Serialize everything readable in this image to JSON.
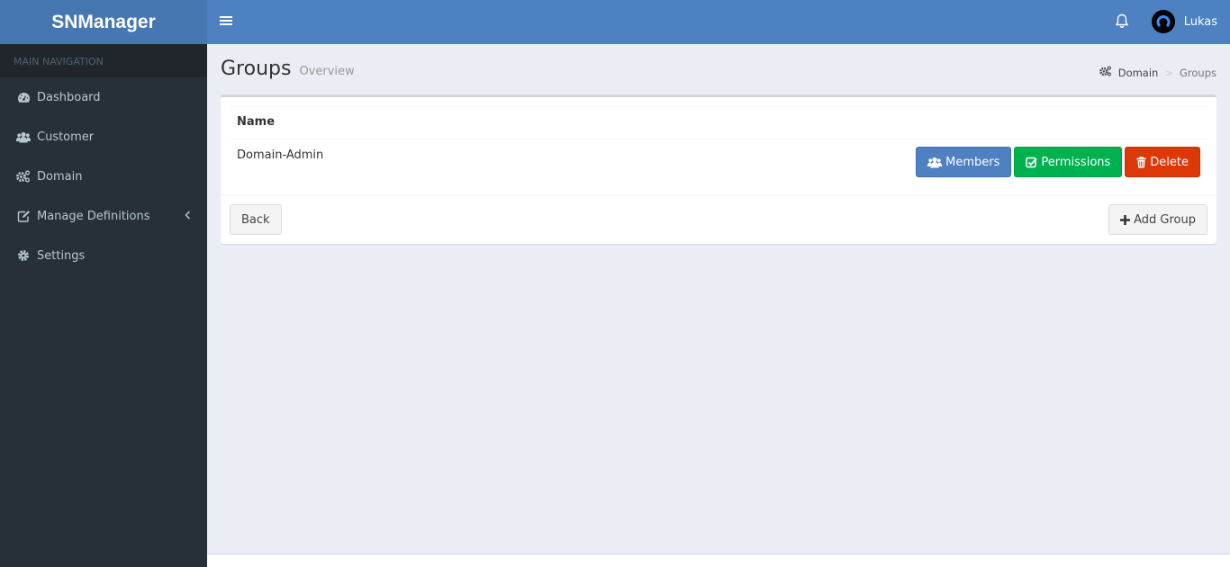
{
  "app": {
    "logo_bold": "SN",
    "logo_rest": "Manager"
  },
  "navbar": {
    "menu_toggle_icon": "hamburger-icon",
    "notifications_icon": "bell-icon",
    "user_name": "Lukas"
  },
  "sidebar": {
    "header": "MAIN NAVIGATION",
    "items": [
      {
        "label": "Dashboard",
        "icon": "dashboard-icon"
      },
      {
        "label": "Customer",
        "icon": "users-icon"
      },
      {
        "label": "Domain",
        "icon": "cogs-icon"
      },
      {
        "label": "Manage Definitions",
        "icon": "edit-icon",
        "has_submenu": true
      },
      {
        "label": "Settings",
        "icon": "gear-icon"
      }
    ]
  },
  "page": {
    "title": "Groups",
    "subtitle": "Overview",
    "breadcrumb": {
      "items": [
        "Domain",
        "Groups"
      ],
      "separator": ">"
    }
  },
  "table": {
    "columns": [
      "Name"
    ],
    "rows": [
      {
        "name": "Domain-Admin",
        "actions": [
          {
            "label": "Members",
            "icon": "users-icon",
            "color": "#4e80c2"
          },
          {
            "label": "Permissions",
            "icon": "check-square-icon",
            "color": "#00b14f"
          },
          {
            "label": "Delete",
            "icon": "trash-icon",
            "color": "#dd3808"
          }
        ]
      }
    ]
  },
  "footer_buttons": {
    "back": "Back",
    "add_group": "Add Group"
  },
  "colors": {
    "header_blue": "#4e81c2",
    "logo_blue": "#4677b1",
    "sidebar_bg": "#283037",
    "content_bg": "#ebedf5"
  }
}
